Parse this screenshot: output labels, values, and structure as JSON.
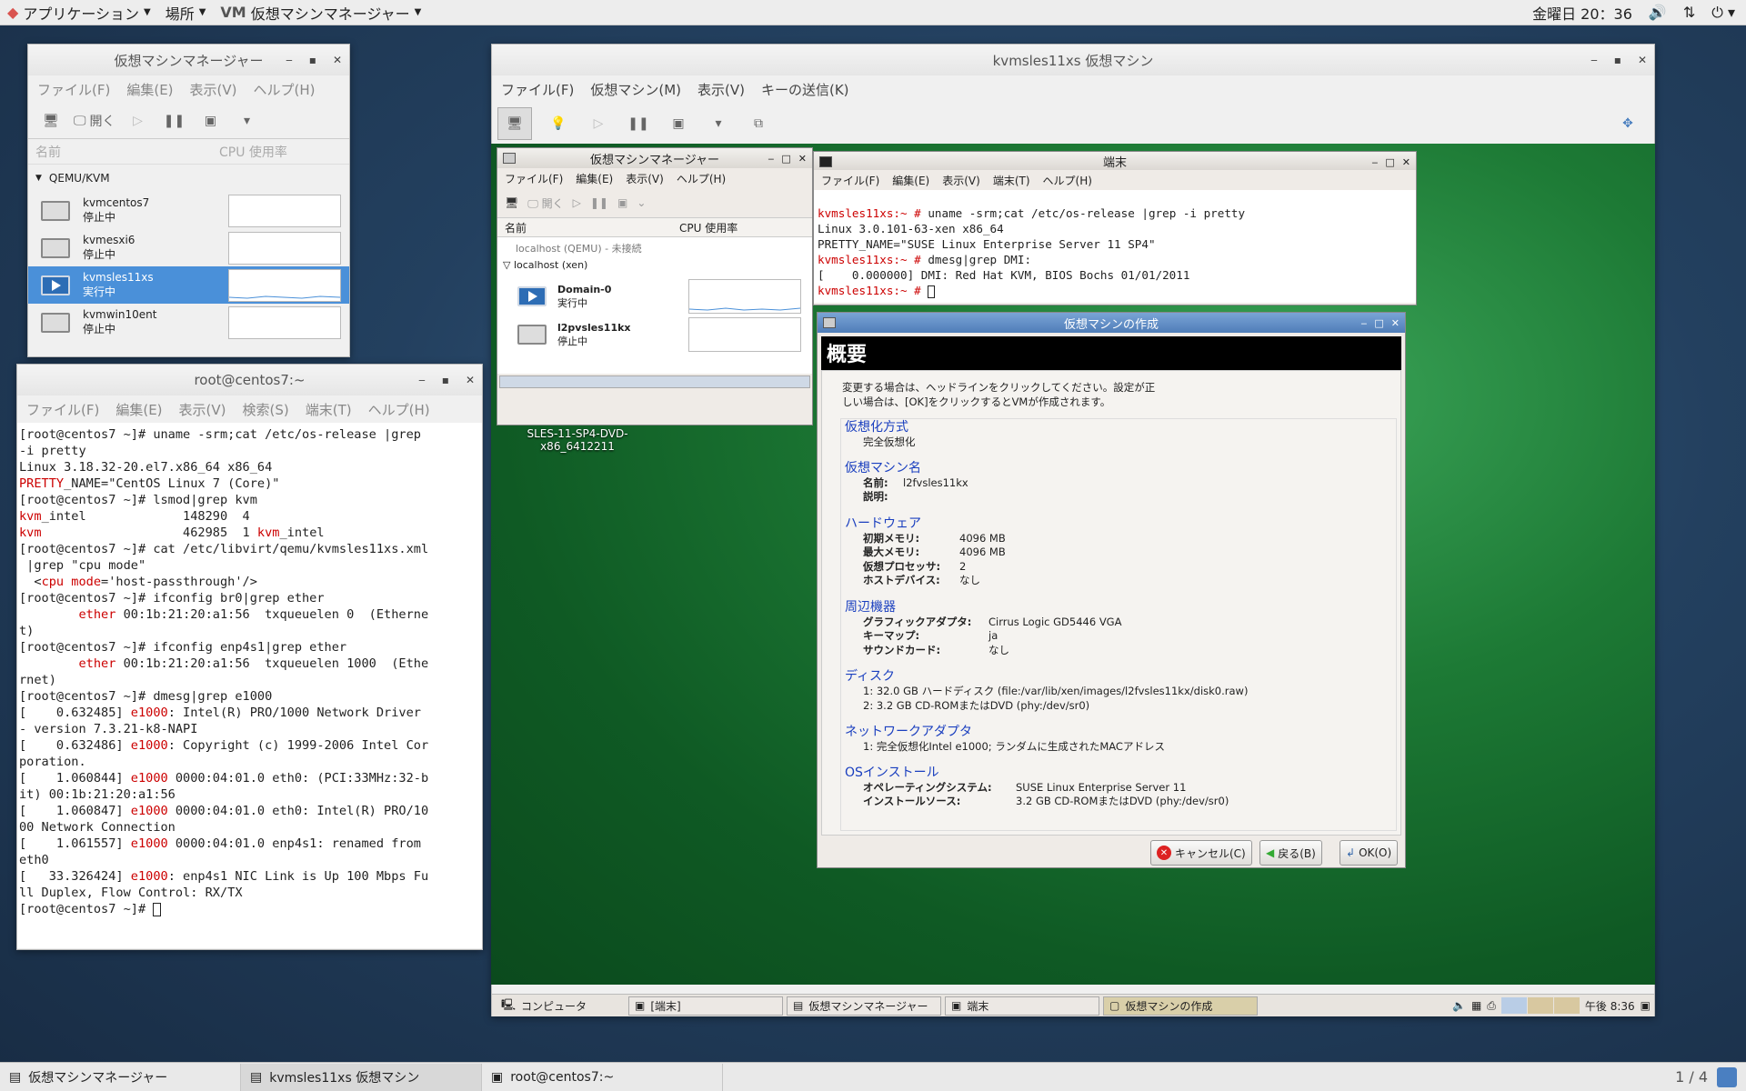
{
  "topbar": {
    "apps": "アプリケーション",
    "places": "場所",
    "vmm": "仮想マシンマネージャー",
    "datetime": "金曜日 20：36"
  },
  "vmm_host": {
    "title": "仮想マシンマネージャー",
    "menus": [
      "ファイル(F)",
      "編集(E)",
      "表示(V)",
      "ヘルプ(H)"
    ],
    "open": "開く",
    "col_name": "名前",
    "col_cpu": "CPU 使用率",
    "group": "QEMU/KVM",
    "vms": [
      {
        "name": "kvmcentos7",
        "state": "停止中"
      },
      {
        "name": "kvmesxi6",
        "state": "停止中"
      },
      {
        "name": "kvmsles11xs",
        "state": "実行中"
      },
      {
        "name": "kvmwin10ent",
        "state": "停止中"
      }
    ]
  },
  "host_term": {
    "title": "root@centos7:~",
    "menus": [
      "ファイル(F)",
      "編集(E)",
      "表示(V)",
      "検索(S)",
      "端末(T)",
      "ヘルプ(H)"
    ],
    "lines": [
      "[root@centos7 ~]# uname -srm;cat /etc/os-release |grep",
      "-i pretty",
      "Linux 3.18.32-20.el7.x86_64 x86_64",
      "PRETTY_NAME=\"CentOS Linux 7 (Core)\"",
      "[root@centos7 ~]# lsmod|grep kvm",
      "kvm_intel             148290  4",
      "kvm                   462985  1 kvm_intel",
      "[root@centos7 ~]# cat /etc/libvirt/qemu/kvmsles11xs.xml",
      " |grep \"cpu mode\"",
      "  <cpu mode='host-passthrough'/>",
      "[root@centos7 ~]# ifconfig br0|grep ether",
      "        ether 00:1b:21:20:a1:56  txqueuelen 0  (Etherne",
      "t)",
      "[root@centos7 ~]# ifconfig enp4s1|grep ether",
      "        ether 00:1b:21:20:a1:56  txqueuelen 1000  (Ethe",
      "rnet)",
      "[root@centos7 ~]# dmesg|grep e1000",
      "[    0.632485] e1000: Intel(R) PRO/1000 Network Driver",
      "- version 7.3.21-k8-NAPI",
      "[    0.632486] e1000: Copyright (c) 1999-2006 Intel Cor",
      "poration.",
      "[    1.060844] e1000 0000:04:01.0 eth0: (PCI:33MHz:32-b",
      "it) 00:1b:21:20:a1:56",
      "[    1.060847] e1000 0000:04:01.0 eth0: Intel(R) PRO/10",
      "00 Network Connection",
      "[    1.061557] e1000 0000:04:01.0 enp4s1: renamed from",
      "eth0",
      "[   33.326424] e1000: enp4s1 NIC Link is Up 100 Mbps Fu",
      "ll Duplex, Flow Control: RX/TX",
      "[root@centos7 ~]# "
    ]
  },
  "vm_window": {
    "title": "kvmsles11xs 仮想マシン",
    "menus": [
      "ファイル(F)",
      "仮想マシン(M)",
      "表示(V)",
      "キーの送信(K)"
    ]
  },
  "guest_vmm": {
    "title": "仮想マシンマネージャー",
    "menus": [
      "ファイル(F)",
      "編集(E)",
      "表示(V)",
      "ヘルプ(H)"
    ],
    "open": "開く",
    "col_name": "名前",
    "col_cpu": "CPU 使用率",
    "conn1": "localhost (QEMU) - 未接続",
    "conn2": "localhost (xen)",
    "vms": [
      {
        "name": "Domain-0",
        "state": "実行中"
      },
      {
        "name": "l2pvsles11kx",
        "state": "停止中"
      }
    ]
  },
  "desktop_icon": {
    "line1": "SLES-11-SP4-DVD-",
    "line2": "x86_6412211"
  },
  "guest_term": {
    "title": "端末",
    "menus": [
      "ファイル(F)",
      "編集(E)",
      "表示(V)",
      "端末(T)",
      "ヘルプ(H)"
    ],
    "prompt": "kvmsles11xs:~ #",
    "cmd1": " uname -srm;cat /etc/os-release |grep -i pretty",
    "out1": "Linux 3.0.101-63-xen x86_64",
    "out2": "PRETTY_NAME=\"SUSE Linux Enterprise Server 11 SP4\"",
    "cmd2": " dmesg|grep DMI:",
    "out3": "[    0.000000] DMI: Red Hat KVM, BIOS Bochs 01/01/2011"
  },
  "create_vm": {
    "title": "仮想マシンの作成",
    "header": "概要",
    "intro1": "変更する場合は、ヘッドラインをクリックしてください。設定が正",
    "intro2": "しい場合は、[OK]をクリックするとVMが作成されます。",
    "virt_h": "仮想化方式",
    "virt_v": "完全仮想化",
    "name_h": "仮想マシン名",
    "name_k": "名前:",
    "name_v": "l2fvsles11kx",
    "desc_k": "説明:",
    "hw_h": "ハードウェア",
    "mem_k": "初期メモリ:",
    "mem_v": "4096 MB",
    "maxmem_k": "最大メモリ:",
    "maxmem_v": "4096 MB",
    "cpu_k": "仮想プロセッサ:",
    "cpu_v": "2",
    "hostdev_k": "ホストデバイス:",
    "hostdev_v": "なし",
    "periph_h": "周辺機器",
    "gfx_k": "グラフィックアダプタ:",
    "gfx_v": "Cirrus Logic GD5446 VGA",
    "kb_k": "キーマップ:",
    "kb_v": "ja",
    "snd_k": "サウンドカード:",
    "snd_v": "なし",
    "disk_h": "ディスク",
    "disk1": "1: 32.0 GB ハードディスク (file:/var/lib/xen/images/l2fvsles11kx/disk0.raw)",
    "disk2": "2: 3.2 GB CD-ROMまたはDVD (phy:/dev/sr0)",
    "net_h": "ネットワークアダプタ",
    "net1": "1: 完全仮想化Intel e1000; ランダムに生成されたMACアドレス",
    "os_h": "OSインストール",
    "os_k": "オペレーティングシステム:",
    "os_v": "SUSE Linux Enterprise Server 11",
    "src_k": "インストールソース:",
    "src_v": "3.2 GB CD-ROMまたはDVD (phy:/dev/sr0)",
    "cancel": "キャンセル(C)",
    "back": "戻る(B)",
    "ok": "OK(O)"
  },
  "guest_taskbar": {
    "computer": "コンピュータ",
    "t1": "[端末]",
    "t2": "仮想マシンマネージャー",
    "t3": "端末",
    "t4": "仮想マシンの作成",
    "clock": "午後 8:36"
  },
  "host_taskbar": {
    "t1": "仮想マシンマネージャー",
    "t2": "kvmsles11xs 仮想マシン",
    "t3": "root@centos7:~",
    "pager": "1 / 4"
  }
}
